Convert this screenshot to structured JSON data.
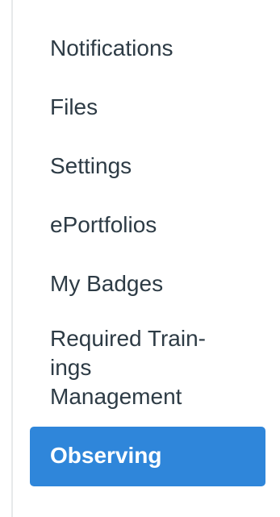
{
  "menu": {
    "items": [
      {
        "label": "Notifications"
      },
      {
        "label": "Files"
      },
      {
        "label": "Settings"
      },
      {
        "label": "ePortfolios"
      },
      {
        "label": "My Badges"
      },
      {
        "label": "Required Train-ings Management"
      },
      {
        "label": "Observing",
        "active": true
      }
    ],
    "active_color": "#2f86da",
    "text_color": "#2d3b45"
  }
}
